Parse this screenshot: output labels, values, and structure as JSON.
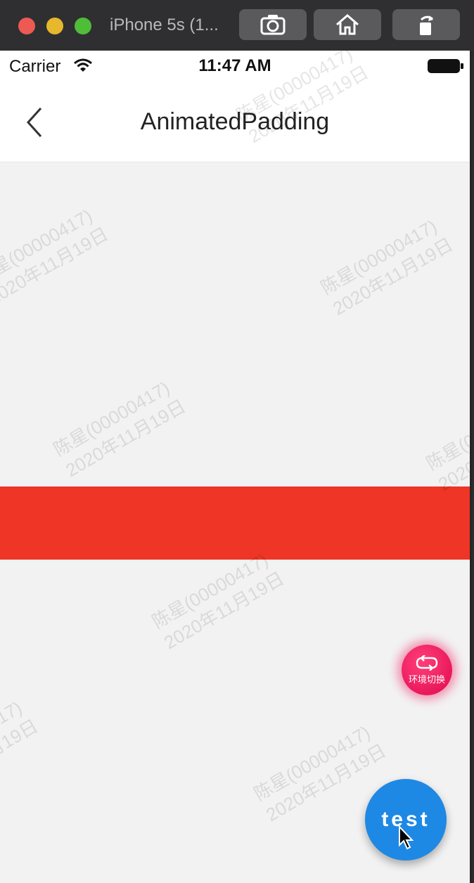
{
  "window": {
    "title": "iPhone 5s (1...",
    "buttons": [
      "screenshot-icon",
      "home-icon",
      "rotate-icon"
    ]
  },
  "status_bar": {
    "carrier": "Carrier",
    "time": "11:47 AM"
  },
  "nav": {
    "title": "AnimatedPadding"
  },
  "watermark": {
    "line1": "陈星(00000417)",
    "line2": "2020年11月19日"
  },
  "env_button": {
    "label": "环境切换"
  },
  "fab": {
    "label": "test"
  },
  "colors": {
    "band": "#ee3526",
    "fab": "#1e88e5",
    "env_button": "#e8105a"
  }
}
